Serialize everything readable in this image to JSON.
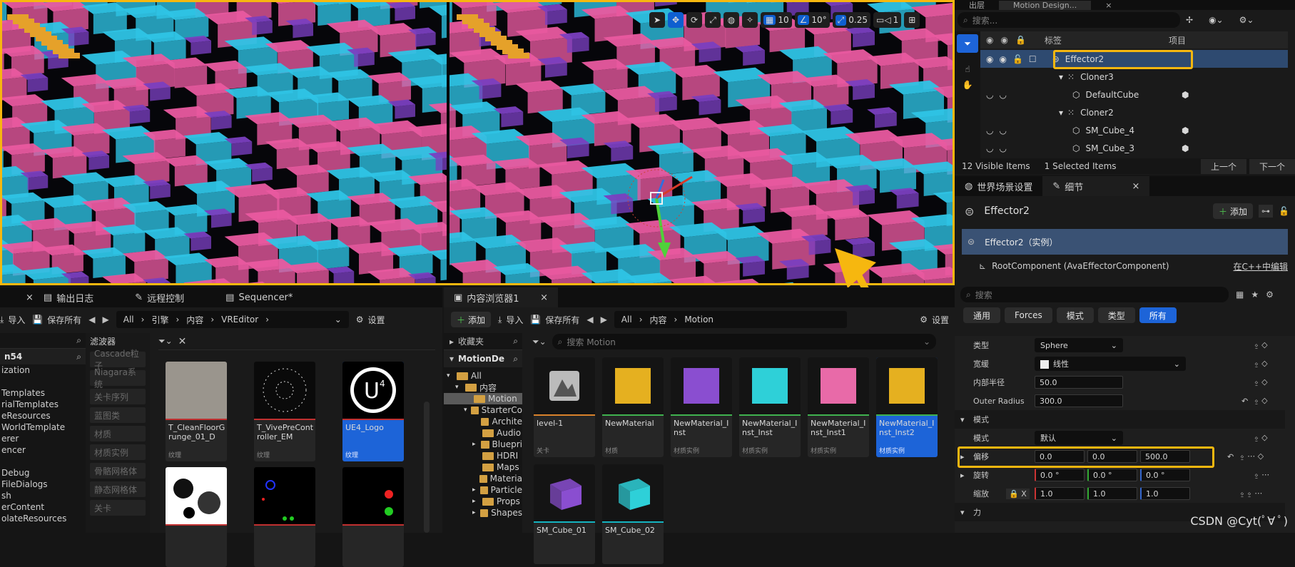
{
  "colors": {
    "accent": "#f6b70f",
    "selection": "#1d64d8",
    "cube_cyan": "#2ec4e6",
    "cube_pink": "#e95aa0",
    "cube_purple": "#7a3fc0",
    "cube_orange": "#e5a12a"
  },
  "viewport": {
    "toolbar": {
      "grid_value": "10",
      "angle_value": "10°",
      "scale_value": "0.25",
      "camera_value": "1"
    }
  },
  "outliner": {
    "top_tabs": [
      "出层",
      "Motion Design...",
      "×"
    ],
    "search_placeholder": "搜索...",
    "col_label": "标签",
    "col_project": "项目",
    "rows": [
      {
        "label": "Effector2"
      },
      {
        "label": "Cloner3"
      },
      {
        "label": "DefaultCube"
      },
      {
        "label": "Cloner2"
      },
      {
        "label": "SM_Cube_4"
      },
      {
        "label": "SM_Cube_3"
      }
    ],
    "visible_items": "12  Visible Items",
    "selected_items": "1 Selected Items",
    "prev_button": "上一个",
    "next_button": "下一个"
  },
  "details": {
    "tabs": [
      "世界场景设置",
      "细节"
    ],
    "close": "×",
    "actor_name": "Effector2",
    "add_button": "添加",
    "instance": "Effector2（实例）",
    "root_component": "RootComponent (AvaEffectorComponent)",
    "edit_cpp": "在C++中编辑",
    "search_placeholder": "搜索",
    "filters": [
      "通用",
      "Forces",
      "模式",
      "类型",
      "所有"
    ],
    "props": {
      "type_label": "类型",
      "type_value": "Sphere",
      "easing_label": "宽缓",
      "easing_value": "线性",
      "inner_label": "内部半径",
      "inner_value": "50.0",
      "outer_label": "Outer Radius",
      "outer_value": "300.0",
      "mode_section": "模式",
      "mode_label": "模式",
      "mode_value": "默认",
      "offset_label": "偏移",
      "offset_x": "0.0",
      "offset_y": "0.0",
      "offset_z": "500.0",
      "rotate_label": "旋转",
      "rotate_x": "0.0 °",
      "rotate_y": "0.0 °",
      "rotate_z": "0.0 °",
      "scale_label": "缩放",
      "scale_lock": "X",
      "scale_x": "1.0",
      "scale_y": "1.0",
      "scale_z": "1.0",
      "force_section": "力"
    }
  },
  "left_browser": {
    "tabs": [
      "输出日志",
      "远程控制",
      "Sequencer*"
    ],
    "close": "×",
    "import": "导入",
    "save_all": "保存所有",
    "path": [
      "All",
      "引擎",
      "内容",
      "VREditor"
    ],
    "settings": "设置",
    "filter_header": "滤波器",
    "filters": [
      "Cascade粒子",
      "Niagara系统",
      "关卡序列",
      "蓝图类",
      "材质",
      "材质实例",
      "骨骼网格体",
      "静态网格体",
      "关卡"
    ],
    "tree_search": "n54",
    "tree": [
      "ization",
      "",
      "Templates",
      "rialTemplates",
      "eResources",
      "WorldTemplate",
      "erer",
      "encer",
      "",
      "Debug",
      "FileDialogs",
      "sh",
      "erContent",
      "olateResources"
    ],
    "assets": [
      {
        "name": "T_CleanFloorGrunge_01_D",
        "type": "纹理"
      },
      {
        "name": "T_VivePreController_EM",
        "type": "纹理"
      },
      {
        "name": "UE4_Logo",
        "type": "纹理"
      },
      {
        "name": "",
        "type": ""
      },
      {
        "name": "",
        "type": ""
      },
      {
        "name": "",
        "type": ""
      }
    ]
  },
  "content_browser": {
    "tab": "内容浏览器1",
    "close": "×",
    "add": "添加",
    "import": "导入",
    "save_all": "保存所有",
    "path": [
      "All",
      "内容",
      "Motion"
    ],
    "settings": "设置",
    "favorites": "收藏夹",
    "project": "MotionDe",
    "search_placeholder": "搜索 Motion",
    "tree": [
      "All",
      "内容",
      "Motion",
      "StarterCo",
      "Archite",
      "Audio",
      "Bluepri",
      "HDRI",
      "Maps",
      "Materia",
      "Particle",
      "Props",
      "Shapes"
    ],
    "assets": [
      {
        "name": "level-1",
        "type": "关卡"
      },
      {
        "name": "NewMaterial",
        "type": "材质"
      },
      {
        "name": "NewMaterial_Inst",
        "type": "材质实例"
      },
      {
        "name": "NewMaterial_Inst_Inst",
        "type": "材质实例"
      },
      {
        "name": "NewMaterial_Inst_Inst1",
        "type": "材质实例"
      },
      {
        "name": "NewMaterial_Inst_Inst2",
        "type": "材质实例"
      },
      {
        "name": "SM_Cube_01",
        "type": ""
      },
      {
        "name": "SM_Cube_02",
        "type": ""
      }
    ]
  },
  "watermark": "CSDN @Cyt(ﾟ∀ ﾟ)"
}
